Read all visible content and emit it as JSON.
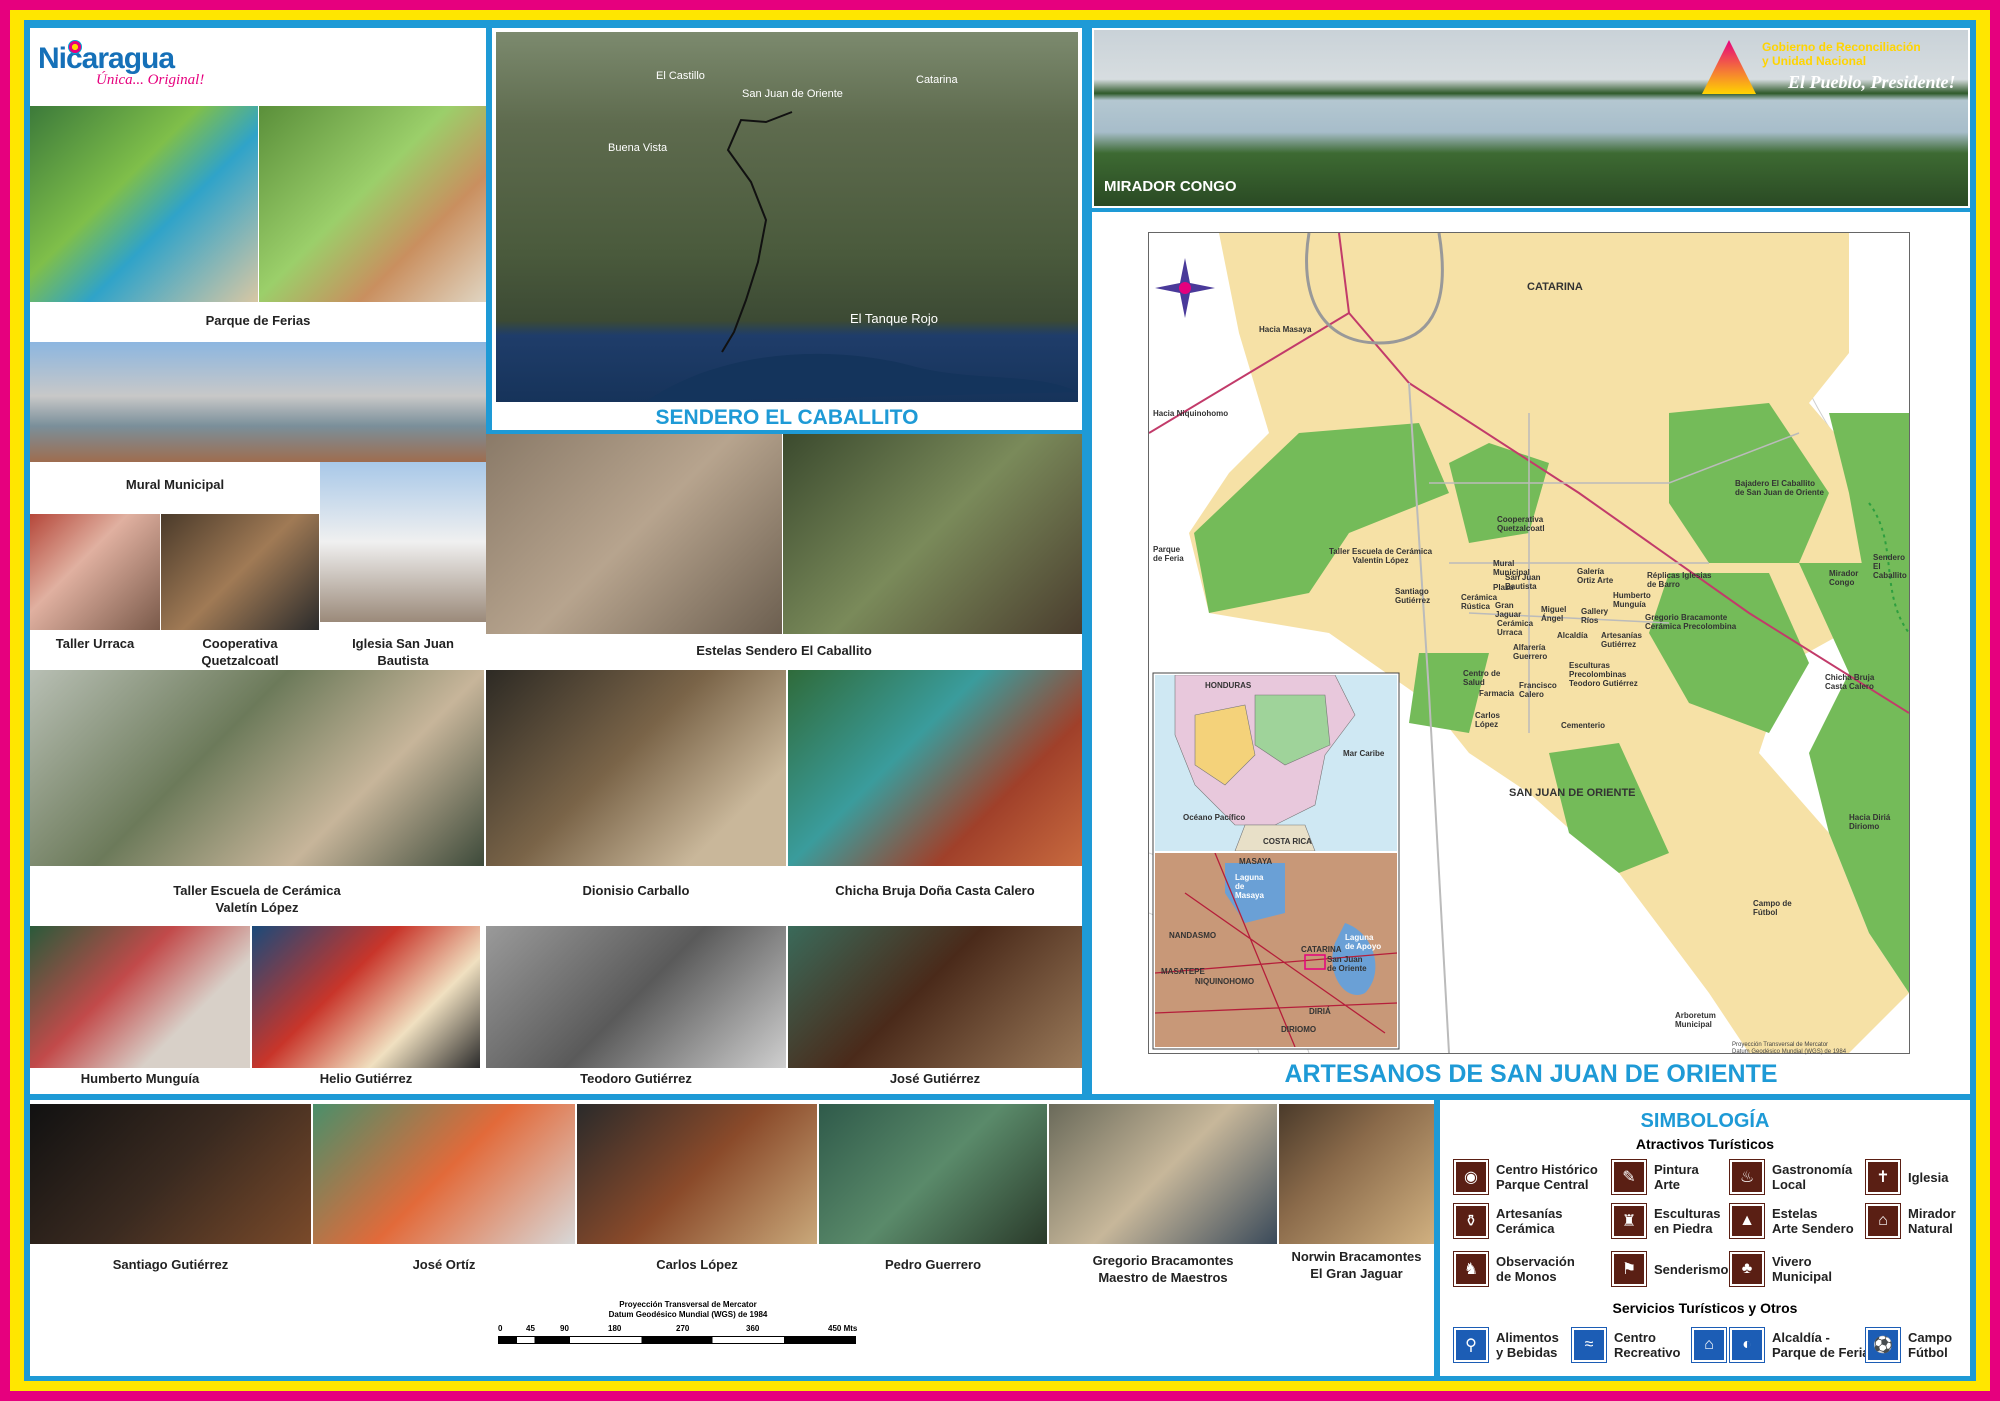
{
  "header": {
    "logo_text": "Nicaragua",
    "logo_tagline": "Única... Original!",
    "gov_line1": "Gobierno de Reconciliación",
    "gov_line2": "y Unidad Nacional",
    "gov_slogan": "El Pueblo, Presidente!"
  },
  "left_photos": {
    "parque_ferias": "Parque de Ferias",
    "mural": "Mural Municipal",
    "urraca": "Taller Urraca",
    "quetzalcoatl": "Cooperativa\nQuetzalcoatl",
    "iglesia": "Iglesia San Juan\nBautista",
    "estelas": "Estelas Sendero El Caballito",
    "taller_escuela": "Taller Escuela de Cerámica\nValetín López",
    "dionisio": "Dionisio Carballo",
    "chicha": "Chicha Bruja Doña Casta Calero",
    "humberto": "Humberto Munguía",
    "helio": "Helio Gutiérrez",
    "teodoro": "Teodoro Gutiérrez",
    "jose_g": "José Gutiérrez"
  },
  "satellite": {
    "title": "SENDERO EL CABALLITO",
    "labels": {
      "castillo": "El Castillo",
      "sanjuan": "San Juan de Oriente",
      "catarina": "Catarina",
      "buenavista": "Buena Vista",
      "tanque": "El Tanque Rojo"
    }
  },
  "mirador": {
    "label": "MIRADOR CONGO"
  },
  "map": {
    "title": "ARTESANOS DE SAN JUAN DE ORIENTE",
    "town_catarina": "CATARINA",
    "town_sanjuan": "SAN JUAN DE ORIENTE",
    "labels": {
      "parque_feria": "Parque\nde Feria",
      "taller_escuela": "Taller Escuela de Cerámica\nValentín López",
      "santiago": "Santiago\nGutiérrez",
      "cooperativa": "Cooperativa\nQuetzalcoatl",
      "mural": "Mural\nMunicipal",
      "plaza": "Plaza",
      "sanjuan_b": "San Juan\nBautista",
      "ceramica_rustica": "Cerámica\nRústica",
      "gran_jaguar": "Gran\nJaguar",
      "urraca": "Cerámica\nUrraca",
      "galeria_ortiz": "Galería\nOrtiz Arte",
      "miguel_angel": "Miguel\nÁngel",
      "gallery_rios": "Gallery\nRíos",
      "alcaldia": "Alcaldía",
      "replicas": "Réplicas Iglesias\nde Barro",
      "humberto": "Humberto\nMunguía",
      "gregorio": "Gregorio Bracamonte\nCerámica Precolombina",
      "artesanias_gutierrez": "Artesanías\nGutiérrez",
      "alfareria_guerrero": "Alfarería\nGuerrero",
      "escultura": "Esculturas\nPrecolombinas\nTeodoro Gutiérrez",
      "centro_salud": "Centro de\nSalud",
      "farmacia": "Farmacia",
      "francisco": "Francisco\nCalero",
      "carlos": "Carlos\nLópez",
      "cementerio": "Cementerio",
      "bajadero": "Bajadero El Caballito\nde San Juan de Oriente",
      "mirador_congo": "Mirador\nCongo",
      "sendero": "Sendero\nEl Caballito",
      "chicha": "Chicha Bruja\nCasta Calero",
      "campo_futbol": "Campo de\nFútbol",
      "arboretum": "Arboretum\nMunicipal",
      "hacia_masaya": "Hacia Masaya",
      "hacia_niquinohomo": "Hacia Niquinohomo",
      "hacia_diria": "Hacia Diriá\nDiriomo"
    },
    "inset_top": {
      "honduras": "HONDURAS",
      "mar_caribe": "Mar Caribe",
      "oceano": "Océano Pacífico",
      "costa_rica": "COSTA RICA"
    },
    "inset_bottom": {
      "masaya": "MASAYA",
      "laguna_masaya": "Laguna\nde\nMasaya",
      "nandasmo": "NANDASMO",
      "masatepe": "MASATEPE",
      "niquinohomo": "NIQUINOHOMO",
      "catarina": "CATARINA",
      "sanjuan": "San Juan\nde Oriente",
      "laguna_apoyo": "Laguna\nde Apoyo",
      "diria": "DIRIÁ",
      "diriomo": "DIRIOMO"
    },
    "projection_note": "Proyección Transversal de Mercator\nDatum Geodésico Mundial (WGS) de 1984"
  },
  "bottom_photos": {
    "santiago": "Santiago Gutiérrez",
    "jose_ortiz": "José Ortíz",
    "carlos": "Carlos López",
    "pedro": "Pedro Guerrero",
    "gregorio": "Gregorio Bracamontes\nMaestro de Maestros",
    "norwin": "Norwin Bracamontes\nEl Gran Jaguar"
  },
  "scale": {
    "title": "Proyección Transversal de Mercator\nDatum Geodésico Mundial (WGS) de 1984",
    "ticks": [
      "0",
      "45",
      "90",
      "180",
      "270",
      "360",
      "450 Mts"
    ]
  },
  "legend": {
    "title": "SIMBOLOGÍA",
    "subtitle1": "Atractivos Turísticos",
    "subtitle2": "Servicios Turísticos y Otros",
    "items": [
      {
        "label": "Centro Histórico\nParque Central",
        "icon": "◉"
      },
      {
        "label": "Pintura\nArte",
        "icon": "✎"
      },
      {
        "label": "Gastronomía\nLocal",
        "icon": "♨"
      },
      {
        "label": "Iglesia",
        "icon": "✝"
      },
      {
        "label": "Artesanías\nCerámica",
        "icon": "⚱"
      },
      {
        "label": "Esculturas\nen Piedra",
        "icon": "♜"
      },
      {
        "label": "Estelas\nArte Sendero",
        "icon": "▲"
      },
      {
        "label": "Mirador\nNatural",
        "icon": "⌂"
      },
      {
        "label": "Observación\nde Monos",
        "icon": "♞"
      },
      {
        "label": "Senderismo",
        "icon": "⚑"
      },
      {
        "label": "Vivero\nMunicipal",
        "icon": "♣"
      }
    ],
    "services": [
      {
        "label": "Alimentos\ny Bebidas",
        "icon": "⚲"
      },
      {
        "label": "Centro\nRecreativo",
        "icon": "≈"
      },
      {
        "label": "Alcaldía -\nParque de Feria",
        "icon": "⌂"
      },
      {
        "label": "Campo\nFútbol",
        "icon": "⚽"
      }
    ]
  }
}
